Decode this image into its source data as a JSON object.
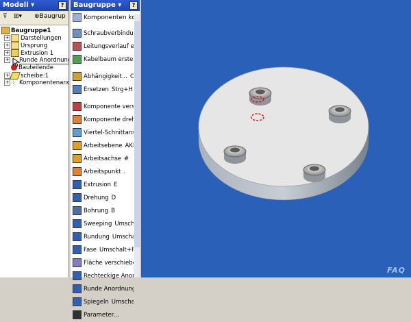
{
  "modell": {
    "title": "Modell",
    "toolbar_label": "Baugrup",
    "help": "?",
    "tree": [
      {
        "label": "Baugruppe1",
        "bold": true
      },
      {
        "label": "Darstellungen"
      },
      {
        "label": "Ursprung"
      },
      {
        "label": "Extrusion 1"
      },
      {
        "label": "Runde Anordnung"
      },
      {
        "label": "Bauteilende"
      },
      {
        "label": "scheibe:1"
      },
      {
        "label": "Komponentenanor"
      }
    ]
  },
  "baugruppe": {
    "title": "Baugruppe",
    "help": "?",
    "top_item": "Komponenten kopie",
    "tools": [
      "Schraubverbindung",
      "Leitungsverlauf ers",
      "Kabelbaum erstelle",
      "Abhängigkeit...",
      "Ersetzen",
      "Komponente versch",
      "Komponente drehe",
      "Viertel-Schnittansic",
      "Arbeitsebene",
      "Arbeitsachse",
      "Arbeitspunkt",
      "Extrusion",
      "Drehung",
      "Bohrung",
      "Sweeping",
      "Rundung",
      "Fase",
      "Fläche verschieben",
      "Rechteckige Anordn",
      "Runde Anordnung",
      "Spiegeln",
      "Parameter..."
    ],
    "shortcuts": [
      "",
      "",
      "",
      "C",
      "Strg+H",
      "",
      "",
      "",
      "AKL",
      "#",
      ".",
      "E",
      "D",
      "B",
      "Umschal",
      "Umscha",
      "Umschalt+F",
      "",
      "",
      "",
      "Umschal",
      ""
    ]
  },
  "viewport": {
    "watermark": "FAQ"
  }
}
